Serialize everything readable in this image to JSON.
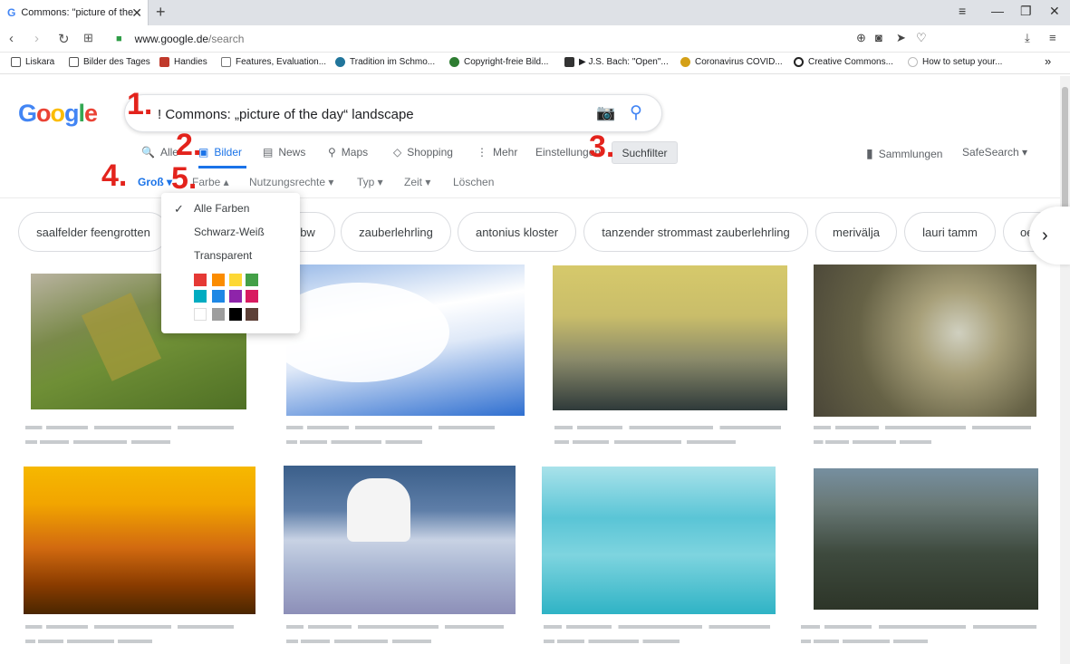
{
  "browser": {
    "tab_title": "Commons: \"picture of the",
    "tab_favicon": "G",
    "url_host": "www.google.de",
    "url_path": "/search",
    "bookmarks": [
      {
        "label": "Liskara",
        "color": "#444"
      },
      {
        "label": "Bilder des Tages",
        "color": "#444"
      },
      {
        "label": "Handies",
        "color": "#c0392b"
      },
      {
        "label": "Features, Evaluation...",
        "color": "#555"
      },
      {
        "label": "Tradition im Schmo...",
        "color": "#21759b"
      },
      {
        "label": "Copyright-freie Bild...",
        "color": "#2e7d32"
      },
      {
        "label": "▶ J.S. Bach: \"Open\"...",
        "color": "#444"
      },
      {
        "label": "Coronavirus COVID...",
        "color": "#d4a017"
      },
      {
        "label": "Creative Commons...",
        "color": "#222"
      },
      {
        "label": "How to setup your...",
        "color": "#ddd"
      }
    ],
    "overflow": "»"
  },
  "google": {
    "query": "! Commons: „picture of the day“ landscape",
    "tabs": [
      {
        "label": "Alle",
        "icon": "🔍"
      },
      {
        "label": "Bilder",
        "icon": "▣"
      },
      {
        "label": "News",
        "icon": "▤"
      },
      {
        "label": "Maps",
        "icon": "⚲"
      },
      {
        "label": "Shopping",
        "icon": "◇"
      },
      {
        "label": "Mehr",
        "icon": "⋮"
      }
    ],
    "einstellungen": "Einstellungen",
    "suchfilter": "Suchfilter",
    "sammlungen": "Sammlungen",
    "safesearch": "SafeSearch ▾",
    "filters": [
      {
        "label": "Groß ▾"
      },
      {
        "label": "Farbe ▴"
      },
      {
        "label": "Nutzungsrechte ▾"
      },
      {
        "label": "Typ ▾"
      },
      {
        "label": "Zeit ▾"
      },
      {
        "label": "Löschen"
      }
    ],
    "chips": [
      "saalfelder feengrotten",
      "",
      "bw",
      "zauberlehrling",
      "antonius kloster",
      "tanzender strommast zauberlehrling",
      "merivälja",
      "lauri tamm",
      "oe"
    ],
    "color_menu": {
      "items": [
        "Alle Farben",
        "Schwarz-Weiß",
        "Transparent"
      ],
      "swatches": [
        "#e53935",
        "#fb8c00",
        "#fdd835",
        "#43a047",
        "#00acc1",
        "#1e88e5",
        "#8e24aa",
        "#d81b60",
        "#ffffff",
        "#9e9e9e",
        "#000000",
        "#5d4037"
      ]
    }
  },
  "annotations": [
    "1.",
    "2.",
    "3.",
    "4.",
    "5."
  ],
  "images": [
    {
      "c1": "#6f8f36",
      "c2": "#b9b3a0",
      "c3": "#4f7025"
    },
    {
      "c1": "#2f6fd0",
      "c2": "#ffffff",
      "c3": "#9bbbe8"
    },
    {
      "c1": "#d6c96b",
      "c2": "#8a8a6a",
      "c3": "#2f3a3a"
    },
    {
      "c1": "#666246",
      "c2": "#a8a07a",
      "c3": "#4a4638"
    },
    {
      "c1": "#f2a500",
      "c2": "#c05a10",
      "c3": "#4a2600"
    },
    {
      "c1": "#3b5f8a",
      "c2": "#f4f4f4",
      "c3": "#aab6d2"
    },
    {
      "c1": "#5ac5d6",
      "c2": "#a9e2ea",
      "c3": "#2fb3c5"
    },
    {
      "c1": "#3e4a3e",
      "c2": "#768fa0",
      "c3": "#2d3528"
    }
  ]
}
